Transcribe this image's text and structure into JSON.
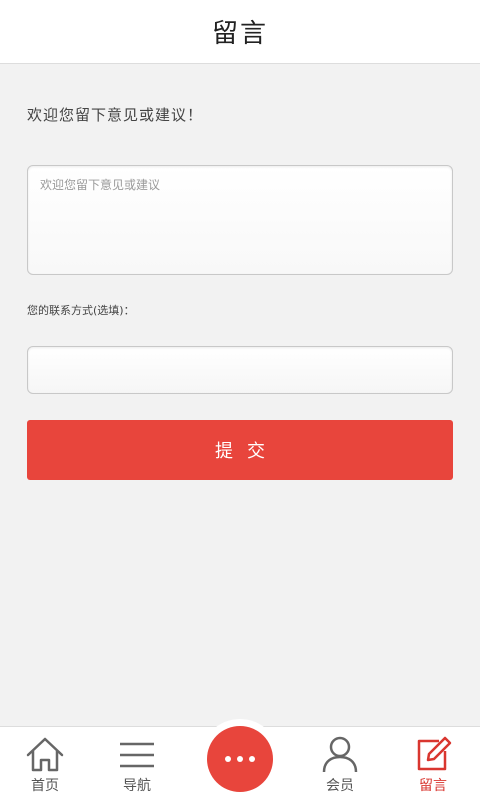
{
  "header": {
    "title": "留言"
  },
  "form": {
    "intro": "欢迎您留下意见或建议！",
    "message_placeholder": "欢迎您留下意见或建议",
    "contact_label": "您的联系方式(选填)：",
    "contact_value": "",
    "submit_label": "提交"
  },
  "nav": {
    "items": [
      {
        "label": "首页",
        "icon": "home-icon"
      },
      {
        "label": "导航",
        "icon": "menu-icon"
      },
      {
        "label": "",
        "icon": "more-icon"
      },
      {
        "label": "会员",
        "icon": "user-icon"
      },
      {
        "label": "留言",
        "icon": "edit-icon",
        "active": true
      }
    ]
  },
  "colors": {
    "accent": "#e8453c",
    "active_nav": "#d9362f",
    "background": "#f2f2f2"
  }
}
